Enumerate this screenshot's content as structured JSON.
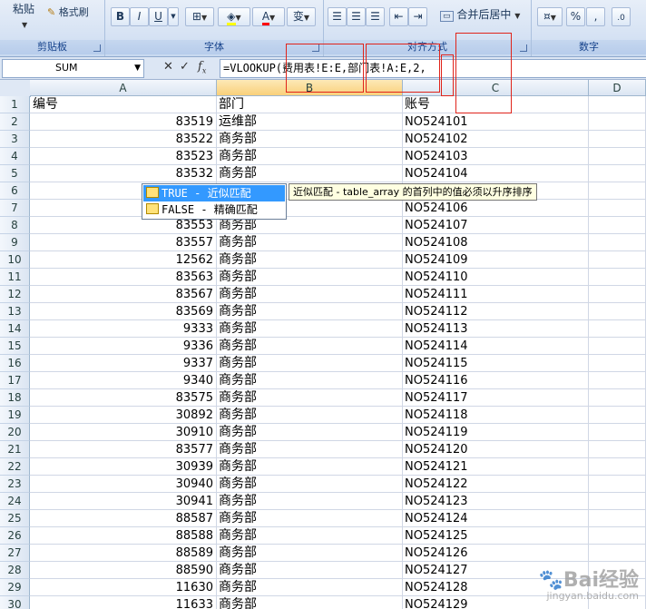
{
  "ribbon": {
    "clipboard": {
      "paste_label": "粘贴",
      "format_painter_label": "格式刷",
      "group_label": "剪贴板"
    },
    "font": {
      "bold": "B",
      "italic": "I",
      "underline": "U",
      "font_color": "A",
      "phonetic": "变",
      "group_label": "字体"
    },
    "alignment": {
      "merge_label": "合并后居中",
      "group_label": "对齐方式"
    },
    "number": {
      "percent": "%",
      "group_label": "数字"
    }
  },
  "formula_bar": {
    "name_box": "SUM",
    "formula": "=VLOOKUP(费用表!E:E,部门表!A:E,2,"
  },
  "columns": [
    "A",
    "B",
    "C",
    "D"
  ],
  "active_column": "B",
  "rows": [
    {
      "n": "1",
      "a": "编号",
      "b": "部门",
      "c": "账号"
    },
    {
      "n": "2",
      "a": "83519",
      "b": "运维部",
      "c": "NO524101"
    },
    {
      "n": "3",
      "a": "83522",
      "b": "商务部",
      "c": "NO524102"
    },
    {
      "n": "4",
      "a": "83523",
      "b": "商务部",
      "c": "NO524103"
    },
    {
      "n": "5",
      "a": "83532",
      "b": "商务部",
      "c": "NO524104"
    },
    {
      "n": "6",
      "a": "",
      "b": "",
      "c": ""
    },
    {
      "n": "7",
      "a": "",
      "b": "",
      "c": "NO524106"
    },
    {
      "n": "8",
      "a": "83553",
      "b": "商务部",
      "c": "NO524107"
    },
    {
      "n": "9",
      "a": "83557",
      "b": "商务部",
      "c": "NO524108"
    },
    {
      "n": "10",
      "a": "12562",
      "b": "商务部",
      "c": "NO524109"
    },
    {
      "n": "11",
      "a": "83563",
      "b": "商务部",
      "c": "NO524110"
    },
    {
      "n": "12",
      "a": "83567",
      "b": "商务部",
      "c": "NO524111"
    },
    {
      "n": "13",
      "a": "83569",
      "b": "商务部",
      "c": "NO524112"
    },
    {
      "n": "14",
      "a": "9333",
      "b": "商务部",
      "c": "NO524113"
    },
    {
      "n": "15",
      "a": "9336",
      "b": "商务部",
      "c": "NO524114"
    },
    {
      "n": "16",
      "a": "9337",
      "b": "商务部",
      "c": "NO524115"
    },
    {
      "n": "17",
      "a": "9340",
      "b": "商务部",
      "c": "NO524116"
    },
    {
      "n": "18",
      "a": "83575",
      "b": "商务部",
      "c": "NO524117"
    },
    {
      "n": "19",
      "a": "30892",
      "b": "商务部",
      "c": "NO524118"
    },
    {
      "n": "20",
      "a": "30910",
      "b": "商务部",
      "c": "NO524119"
    },
    {
      "n": "21",
      "a": "83577",
      "b": "商务部",
      "c": "NO524120"
    },
    {
      "n": "22",
      "a": "30939",
      "b": "商务部",
      "c": "NO524121"
    },
    {
      "n": "23",
      "a": "30940",
      "b": "商务部",
      "c": "NO524122"
    },
    {
      "n": "24",
      "a": "30941",
      "b": "商务部",
      "c": "NO524123"
    },
    {
      "n": "25",
      "a": "88587",
      "b": "商务部",
      "c": "NO524124"
    },
    {
      "n": "26",
      "a": "88588",
      "b": "商务部",
      "c": "NO524125"
    },
    {
      "n": "27",
      "a": "88589",
      "b": "商务部",
      "c": "NO524126"
    },
    {
      "n": "28",
      "a": "88590",
      "b": "商务部",
      "c": "NO524127"
    },
    {
      "n": "29",
      "a": "11630",
      "b": "商务部",
      "c": "NO524128"
    },
    {
      "n": "30",
      "a": "11633",
      "b": "商务部",
      "c": "NO524129"
    }
  ],
  "autocomplete": {
    "items": [
      {
        "label": "TRUE - 近似匹配",
        "selected": true
      },
      {
        "label": "FALSE - 精确匹配",
        "selected": false
      }
    ],
    "tooltip": "近似匹配 - table_array 的首列中的值必须以升序排序"
  },
  "watermark": {
    "brand": "Bai经验",
    "url": "jingyan.baidu.com"
  }
}
